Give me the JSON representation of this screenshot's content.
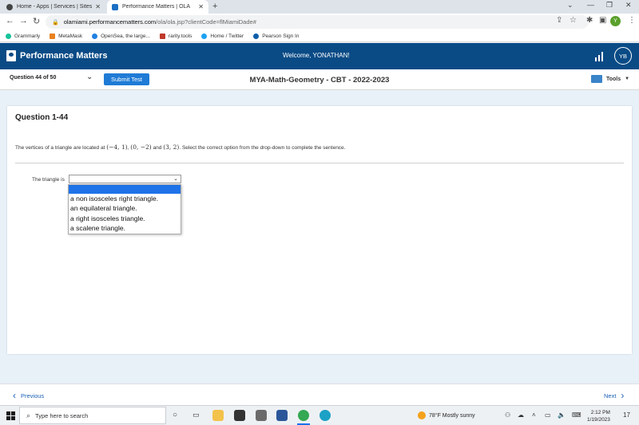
{
  "browser": {
    "tabs": [
      {
        "title": "Home - Apps | Services | Sites",
        "active": false
      },
      {
        "title": "Performance Matters | OLA",
        "active": true
      }
    ],
    "new_tab": "+",
    "url_host": "olamiami.performancematters.com",
    "url_path": "/ola/ola.jsp?clientCode=flMiamiDade#",
    "profile_initial": "Y",
    "bookmarks": [
      "Grammarly",
      "MetaMask",
      "OpenSea, the large...",
      "rarity.tools",
      "Home / Twitter",
      "Pearson Sign In"
    ]
  },
  "app": {
    "brand": "Performance Matters",
    "welcome": "Welcome, YONATHAN!",
    "avatar_initials": "YB",
    "brand_color": "#0a4b86"
  },
  "toolbar": {
    "question_select": "Question 44 of 50",
    "submit_label": "Submit Test",
    "test_title": "MYA-Math-Geometry - CBT - 2022-2023",
    "tools_label": "Tools"
  },
  "question": {
    "title": "Question 1-44",
    "text_prefix": "The vertices of a triangle are located at ",
    "point1": "(−4, 1)",
    "sep1": ", ",
    "point2": "(0, −2)",
    "sep2": " and ",
    "point3": "(3, 2)",
    "text_suffix": ". Select the correct option from the drop-down to complete the sentence.",
    "prompt": "The triangle is",
    "selected_value": "",
    "options": [
      "",
      "a non isosceles right triangle.",
      "an equilateral triangle.",
      "a right isosceles triangle.",
      "a scalene triangle."
    ]
  },
  "footer": {
    "previous": "Previous",
    "next": "Next"
  },
  "taskbar": {
    "search_placeholder": "Type here to search",
    "weather": "78°F  Mostly sunny",
    "time": "2:12 PM",
    "date": "1/19/2023",
    "notification_count": "17"
  }
}
